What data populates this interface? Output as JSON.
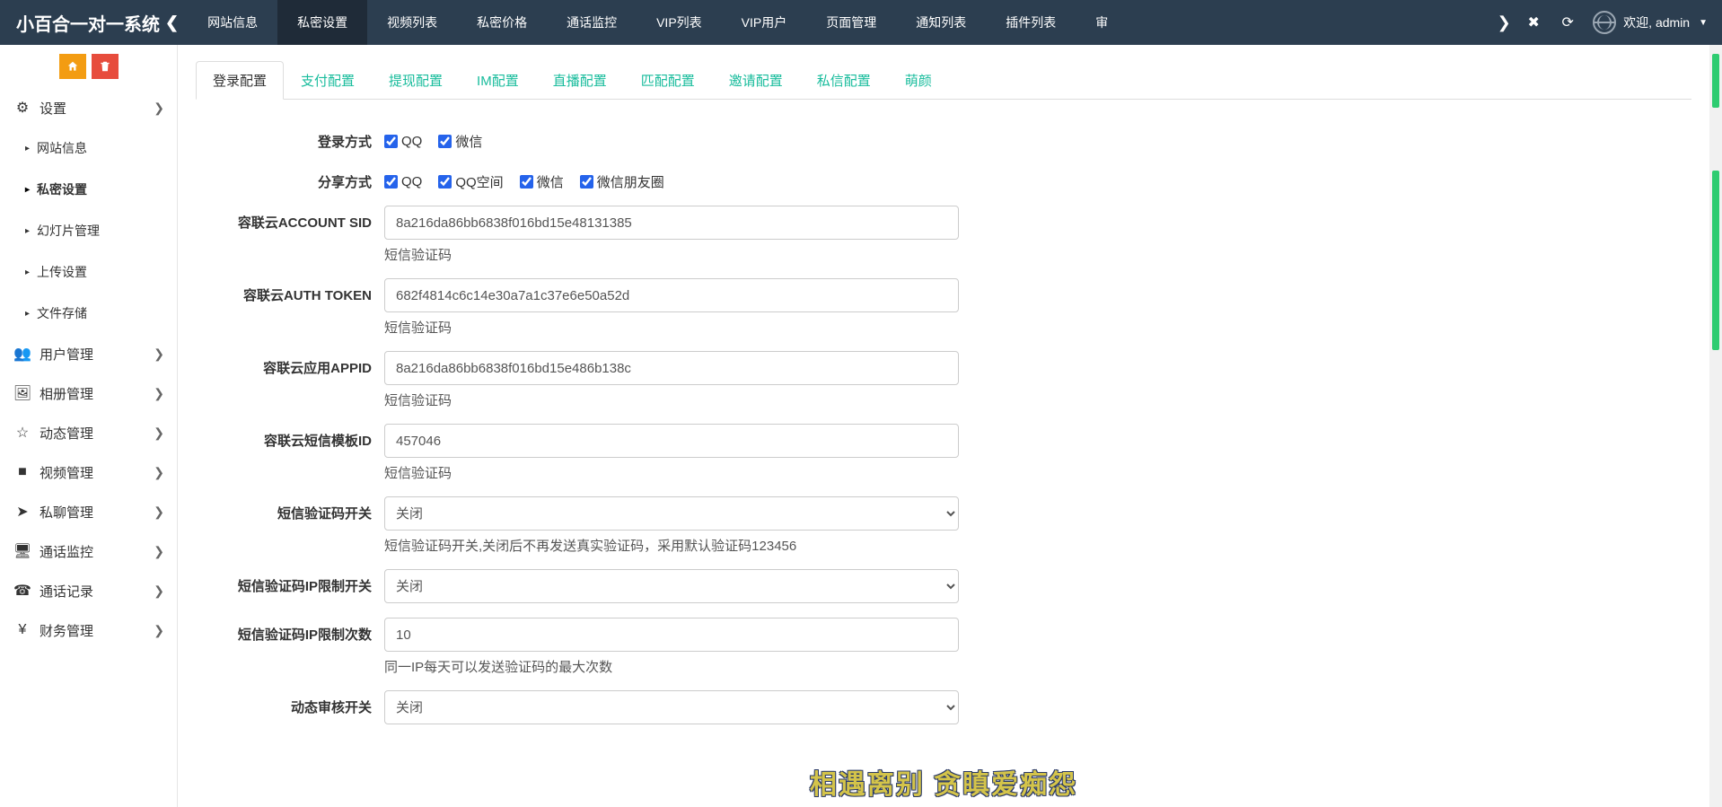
{
  "brand": "小百合一对一系统",
  "topnav": {
    "items": [
      {
        "label": "网站信息",
        "active": false
      },
      {
        "label": "私密设置",
        "active": true
      },
      {
        "label": "视频列表",
        "active": false
      },
      {
        "label": "私密价格",
        "active": false
      },
      {
        "label": "通话监控",
        "active": false
      },
      {
        "label": "VIP列表",
        "active": false
      },
      {
        "label": "VIP用户",
        "active": false
      },
      {
        "label": "页面管理",
        "active": false
      },
      {
        "label": "通知列表",
        "active": false
      },
      {
        "label": "插件列表",
        "active": false
      },
      {
        "label": "审",
        "active": false
      }
    ]
  },
  "user": {
    "welcome": "欢迎",
    "name": "admin"
  },
  "sidebar": {
    "groups": [
      {
        "icon": "⚙",
        "label": "设置",
        "open": true,
        "chev": "❯",
        "items": [
          {
            "label": "网站信息",
            "active": false
          },
          {
            "label": "私密设置",
            "active": true
          },
          {
            "label": "幻灯片管理",
            "active": false
          },
          {
            "label": "上传设置",
            "active": false
          },
          {
            "label": "文件存储",
            "active": false
          }
        ]
      },
      {
        "icon": "👥",
        "label": "用户管理",
        "chev": "❯"
      },
      {
        "icon": "🖼",
        "label": "相册管理",
        "chev": "❯"
      },
      {
        "icon": "☆",
        "label": "动态管理",
        "chev": "❯"
      },
      {
        "icon": "■",
        "label": "视频管理",
        "chev": "❯"
      },
      {
        "icon": "➤",
        "label": "私聊管理",
        "chev": "❯"
      },
      {
        "icon": "🖥",
        "label": "通话监控",
        "chev": "❯"
      },
      {
        "icon": "☎",
        "label": "通话记录",
        "chev": "❯"
      },
      {
        "icon": "¥",
        "label": "财务管理",
        "chev": "❯"
      }
    ]
  },
  "tabs": [
    {
      "label": "登录配置",
      "active": true
    },
    {
      "label": "支付配置"
    },
    {
      "label": "提现配置"
    },
    {
      "label": "IM配置"
    },
    {
      "label": "直播配置"
    },
    {
      "label": "匹配配置"
    },
    {
      "label": "邀请配置"
    },
    {
      "label": "私信配置"
    },
    {
      "label": "萌颜"
    }
  ],
  "form": {
    "login_method": {
      "label": "登录方式",
      "opts": [
        {
          "label": "QQ",
          "checked": true
        },
        {
          "label": "微信",
          "checked": true
        }
      ]
    },
    "share_method": {
      "label": "分享方式",
      "opts": [
        {
          "label": "QQ",
          "checked": true
        },
        {
          "label": "QQ空间",
          "checked": true
        },
        {
          "label": "微信",
          "checked": true
        },
        {
          "label": "微信朋友圈",
          "checked": true
        }
      ]
    },
    "account_sid": {
      "label": "容联云ACCOUNT SID",
      "value": "8a216da86bb6838f016bd15e48131385",
      "help": "短信验证码"
    },
    "auth_token": {
      "label": "容联云AUTH TOKEN",
      "value": "682f4814c6c14e30a7a1c37e6e50a52d",
      "help": "短信验证码"
    },
    "app_id": {
      "label": "容联云应用APPID",
      "value": "8a216da86bb6838f016bd15e486b138c",
      "help": "短信验证码"
    },
    "tpl_id": {
      "label": "容联云短信模板ID",
      "value": "457046",
      "help": "短信验证码"
    },
    "sms_switch": {
      "label": "短信验证码开关",
      "value": "关闭",
      "help": "短信验证码开关,关闭后不再发送真实验证码，采用默认验证码123456"
    },
    "ip_switch": {
      "label": "短信验证码IP限制开关",
      "value": "关闭"
    },
    "ip_count": {
      "label": "短信验证码IP限制次数",
      "value": "10",
      "help": "同一IP每天可以发送验证码的最大次数"
    },
    "dyn_audit": {
      "label": "动态审核开关",
      "value": "关闭"
    }
  },
  "watermark": "相遇离别 贪瞋爱痴怨"
}
